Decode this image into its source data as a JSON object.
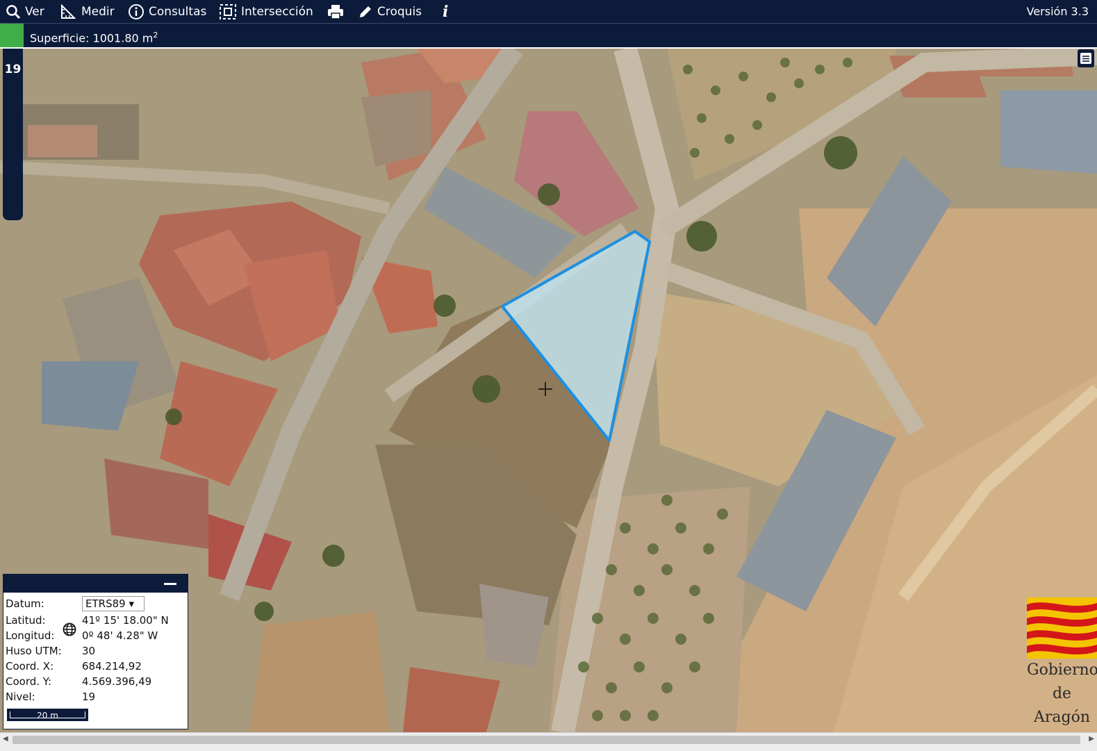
{
  "toolbar": {
    "items": [
      {
        "label": "Ver",
        "icon": "search-icon"
      },
      {
        "label": "Medir",
        "icon": "ruler-icon"
      },
      {
        "label": "Consultas",
        "icon": "info-circle-icon"
      },
      {
        "label": "Intersección",
        "icon": "intersection-icon"
      },
      {
        "label": "",
        "icon": "printer-icon"
      },
      {
        "label": "Croquis",
        "icon": "pencil-icon"
      },
      {
        "label": "",
        "icon": "info-italic-icon"
      }
    ],
    "version": "Versión 3.3"
  },
  "measure": {
    "label": "Superficie: 1001.80 m",
    "unit_exp": "2",
    "color": "#3fae49"
  },
  "zoom": {
    "level": "19"
  },
  "coords": {
    "datum_label": "Datum:",
    "datum_value": "ETRS89 ▾",
    "lat_label": "Latitud:",
    "lat_value": "41º 15' 18.00\" N",
    "lon_label": "Longitud:",
    "lon_value": "0º 48' 4.28\" W",
    "utm_label": "Huso UTM:",
    "utm_value": "30",
    "x_label": "Coord. X:",
    "x_value": "684.214,92",
    "y_label": "Coord. Y:",
    "y_value": "4.569.396,49",
    "level_label": "Nivel:",
    "level_value": "19",
    "scale": "20 m"
  },
  "logo": {
    "line1": "Gobierno",
    "line2": "de",
    "line3": "Aragón"
  },
  "colors": {
    "panel": "#0c1b3a",
    "polygon_stroke": "#1e8fe0",
    "polygon_fill": "#bfe6f4"
  }
}
